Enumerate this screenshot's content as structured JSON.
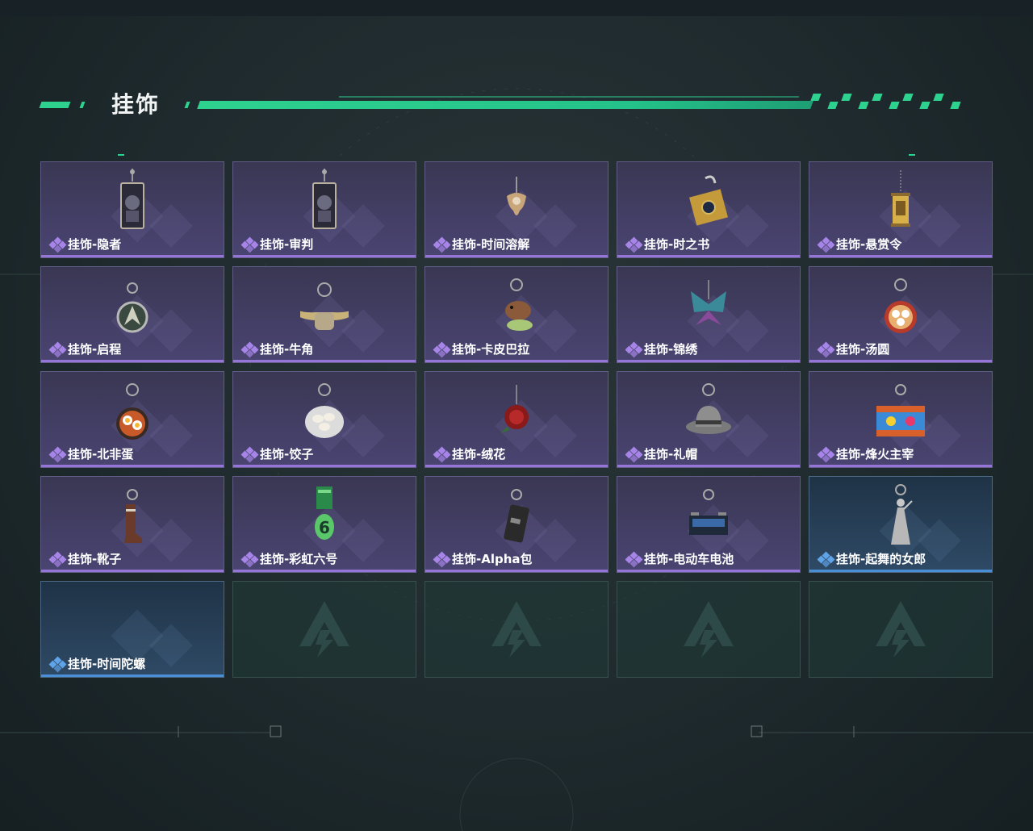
{
  "section": {
    "title": "挂饰"
  },
  "items": [
    {
      "label": "挂饰-隐者",
      "rarity": "purple",
      "icon": "tarot-card-charm-icon"
    },
    {
      "label": "挂饰-审判",
      "rarity": "purple",
      "icon": "tarot-card-charm-icon"
    },
    {
      "label": "挂饰-时间溶解",
      "rarity": "purple",
      "icon": "melting-clock-charm-icon"
    },
    {
      "label": "挂饰-时之书",
      "rarity": "purple",
      "icon": "book-charm-icon"
    },
    {
      "label": "挂饰-悬赏令",
      "rarity": "purple",
      "icon": "bounty-scroll-charm-icon"
    },
    {
      "label": "挂饰-启程",
      "rarity": "purple",
      "icon": "emblem-charm-icon"
    },
    {
      "label": "挂饰-牛角",
      "rarity": "purple",
      "icon": "horns-charm-icon"
    },
    {
      "label": "挂饰-卡皮巴拉",
      "rarity": "purple",
      "icon": "capybara-charm-icon"
    },
    {
      "label": "挂饰-锦绣",
      "rarity": "purple",
      "icon": "butterfly-charm-icon"
    },
    {
      "label": "挂饰-汤圆",
      "rarity": "purple",
      "icon": "rice-ball-bowl-charm-icon"
    },
    {
      "label": "挂饰-北非蛋",
      "rarity": "purple",
      "icon": "egg-pan-charm-icon"
    },
    {
      "label": "挂饰-饺子",
      "rarity": "purple",
      "icon": "dumpling-plate-charm-icon"
    },
    {
      "label": "挂饰-绒花",
      "rarity": "purple",
      "icon": "rose-charm-icon"
    },
    {
      "label": "挂饰-礼帽",
      "rarity": "purple",
      "icon": "fedora-hat-charm-icon"
    },
    {
      "label": "挂饰-烽火主宰",
      "rarity": "purple",
      "icon": "container-charm-icon"
    },
    {
      "label": "挂饰-靴子",
      "rarity": "purple",
      "icon": "boot-charm-icon"
    },
    {
      "label": "挂饰-彩虹六号",
      "rarity": "purple",
      "icon": "rainbow-six-charm-icon"
    },
    {
      "label": "挂饰-Alpha包",
      "rarity": "purple",
      "icon": "alpha-pack-charm-icon"
    },
    {
      "label": "挂饰-电动车电池",
      "rarity": "purple",
      "icon": "battery-charm-icon"
    },
    {
      "label": "挂饰-起舞的女郎",
      "rarity": "blue",
      "icon": "dancing-lady-charm-icon"
    },
    {
      "label": "挂饰-时间陀螺",
      "rarity": "blue",
      "icon": "spinning-top-charm-icon"
    },
    {
      "label": "",
      "rarity": "empty",
      "icon": "empty-slot-logo-icon"
    },
    {
      "label": "",
      "rarity": "empty",
      "icon": "empty-slot-logo-icon"
    },
    {
      "label": "",
      "rarity": "empty",
      "icon": "empty-slot-logo-icon"
    },
    {
      "label": "",
      "rarity": "empty",
      "icon": "empty-slot-logo-icon"
    }
  ],
  "colors": {
    "accent": "#2ed28f",
    "purple_rarity": "#9575d8",
    "blue_rarity": "#4a8fd6",
    "card_purple_bg": "#433e66",
    "card_blue_bg": "#2a4560",
    "empty_slot_bg": "#203a38"
  }
}
